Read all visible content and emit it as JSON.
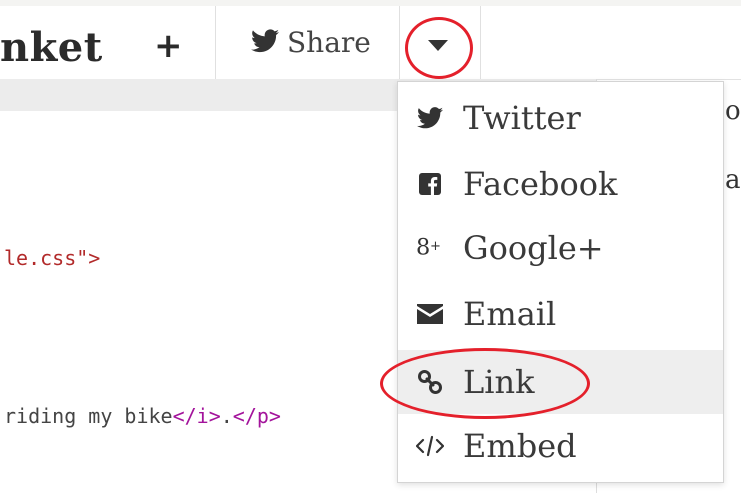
{
  "toolbar": {
    "brand": "nket",
    "new_label": "+",
    "share_label": "Share"
  },
  "editor": {
    "line1_string": "le.css\">",
    "line2_text": "riding my bike",
    "line2_close_i": "</i>",
    "line2_period": ".",
    "line2_close_p": "</p>"
  },
  "preview": {
    "fragment1": "or",
    "fragment2": "an"
  },
  "share_menu": {
    "items": [
      {
        "label": "Twitter",
        "icon": "twitter-icon"
      },
      {
        "label": "Facebook",
        "icon": "facebook-icon"
      },
      {
        "label": "Google+",
        "icon": "google-plus-icon"
      },
      {
        "label": "Email",
        "icon": "email-icon"
      },
      {
        "label": "Link",
        "icon": "link-icon",
        "highlighted": true
      },
      {
        "label": "Embed",
        "icon": "embed-icon"
      }
    ]
  },
  "colors": {
    "annotation_red": "#e4202b",
    "string_red": "#b22a2a",
    "tag_purple": "#a3139b",
    "highlight_bg": "#eeeeee"
  }
}
